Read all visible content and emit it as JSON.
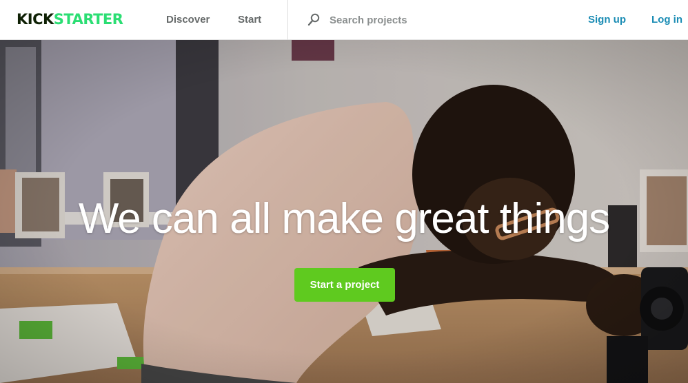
{
  "header": {
    "logo_part1": "KICK",
    "logo_part2": "STARTER",
    "nav": {
      "discover": "Discover",
      "start": "Start"
    },
    "search": {
      "placeholder": "Search projects",
      "value": ""
    },
    "auth": {
      "signup": "Sign up",
      "login": "Log in"
    }
  },
  "hero": {
    "headline": "We can all make great things",
    "cta_label": "Start a project"
  },
  "colors": {
    "brand_dark": "#0f2105",
    "brand_green": "#2bde73",
    "link_blue": "#1a8cb4",
    "cta_green": "#5fca1f",
    "nav_gray": "#656969"
  }
}
